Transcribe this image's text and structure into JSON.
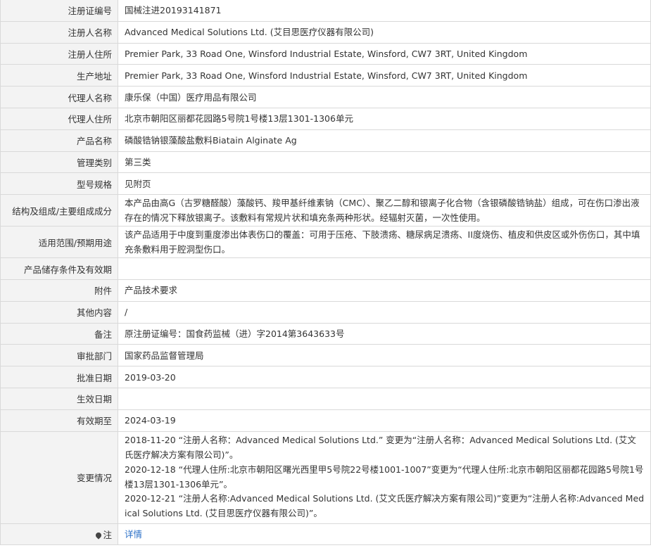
{
  "rows": [
    {
      "label": "注册证编号",
      "value": "国械注进20193141871"
    },
    {
      "label": "注册人名称",
      "value": "Advanced Medical Solutions Ltd. (艾目思医疗仪器有限公司)"
    },
    {
      "label": "注册人住所",
      "value": "Premier Park, 33 Road One, Winsford Industrial Estate, Winsford, CW7 3RT, United Kingdom"
    },
    {
      "label": "生产地址",
      "value": "Premier Park, 33 Road One, Winsford Industrial Estate, Winsford, CW7 3RT, United Kingdom"
    },
    {
      "label": "代理人名称",
      "value": "康乐保（中国）医疗用品有限公司"
    },
    {
      "label": "代理人住所",
      "value": "北京市朝阳区丽都花园路5号院1号楼13层1301-1306单元"
    },
    {
      "label": "产品名称",
      "value": "磷酸锆钠银藻酸盐敷料Biatain Alginate Ag"
    },
    {
      "label": "管理类别",
      "value": "第三类"
    },
    {
      "label": "型号规格",
      "value": "见附页"
    },
    {
      "label": "结构及组成/主要组成成分",
      "value": "本产品由高G（古罗糖醛酸）藻酸钙、羧甲基纤维素钠（CMC）、聚乙二醇和银离子化合物（含银磷酸锆钠盐）组成，可在伤口渗出液存在的情况下释放银离子。该敷料有常规片状和填充条两种形状。经辐射灭菌，一次性使用。"
    },
    {
      "label": "适用范围/预期用途",
      "value": "该产品适用于中度到重度渗出体表伤口的覆盖：可用于压疮、下肢溃疡、糖尿病足溃疡、II度烧伤、植皮和供皮区或外伤伤口，其中填充条敷料用于腔洞型伤口。"
    },
    {
      "label": "产品储存条件及有效期",
      "value": ""
    },
    {
      "label": "附件",
      "value": "产品技术要求"
    },
    {
      "label": "其他内容",
      "value": "/"
    },
    {
      "label": "备注",
      "value": "原注册证编号：国食药监械（进）字2014第3643633号"
    },
    {
      "label": "审批部门",
      "value": "国家药品监督管理局"
    },
    {
      "label": "批准日期",
      "value": "2019-03-20"
    },
    {
      "label": "生效日期",
      "value": ""
    },
    {
      "label": "有效期至",
      "value": "2024-03-19"
    }
  ],
  "changes": {
    "label": "变更情况",
    "items": [
      "2018-11-20 “注册人名称：Advanced Medical Solutions Ltd.” 变更为“注册人名称：Advanced Medical Solutions Ltd. (艾文氏医疗解决方案有限公司)”。",
      "2020-12-18 “代理人住所:北京市朝阳区曙光西里甲5号院22号楼1001-1007”变更为“代理人住所:北京市朝阳区丽都花园路5号院1号楼13层1301-1306单元”。",
      "2020-12-21 “注册人名称:Advanced Medical Solutions Ltd. (艾文氏医疗解决方案有限公司)”变更为“注册人名称:Advanced Medical Solutions Ltd. (艾目思医疗仪器有限公司)”。"
    ]
  },
  "note": {
    "label": "注",
    "icon": "pin-icon",
    "link_text": "详情",
    "link_color": "#2a6fc7"
  },
  "colors": {
    "label_bg": "#f3f3f3",
    "border": "#d9d9d9",
    "text": "#333333"
  }
}
